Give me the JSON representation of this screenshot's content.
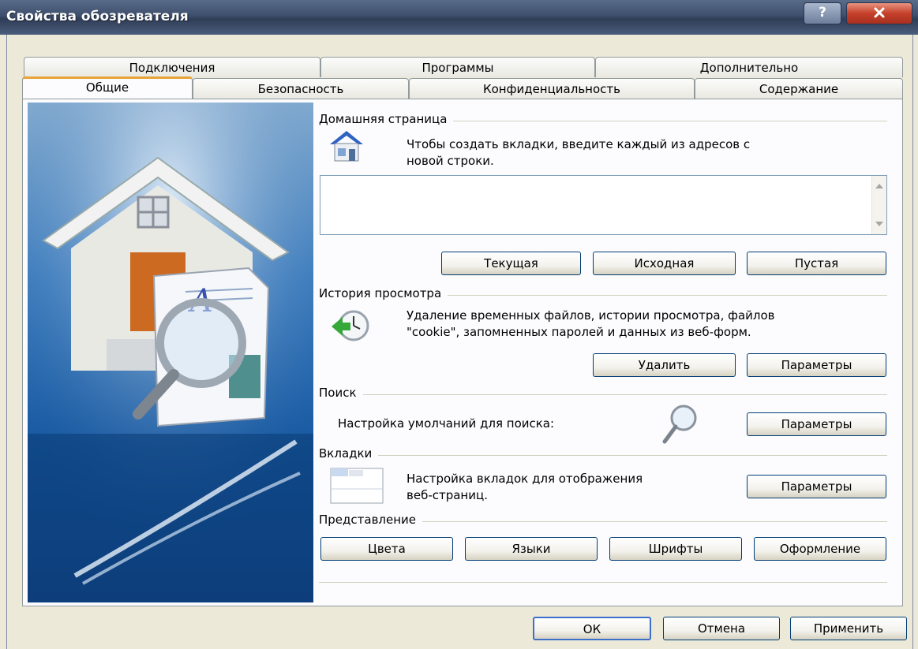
{
  "window": {
    "title": "Свойства обозревателя"
  },
  "tabs": {
    "row1": [
      "Подключения",
      "Программы",
      "Дополнительно"
    ],
    "row2": [
      "Общие",
      "Безопасность",
      "Конфиденциальность",
      "Содержание"
    ]
  },
  "home": {
    "title": "Домашняя страница",
    "desc_line1": "Чтобы создать вкладки, введите каждый из адресов с",
    "desc_line2": "новой строки.",
    "url_value": "",
    "btn_current": "Текущая",
    "btn_default": "Исходная",
    "btn_blank": "Пустая"
  },
  "history": {
    "title": "История просмотра",
    "desc_line1": "Удаление временных файлов, истории просмотра, файлов",
    "desc_line2": "\"cookie\", запомненных паролей и данных из веб-форм.",
    "btn_delete": "Удалить",
    "btn_params": "Параметры"
  },
  "search": {
    "title": "Поиск",
    "desc": "Настройка умолчаний для поиска:",
    "btn_params": "Параметры"
  },
  "tabs_section": {
    "title": "Вкладки",
    "desc_line1": "Настройка вкладок для отображения",
    "desc_line2": "веб-страниц.",
    "btn_params": "Параметры"
  },
  "view": {
    "title": "Представление",
    "btn_colors": "Цвета",
    "btn_languages": "Языки",
    "btn_fonts": "Шрифты",
    "btn_design": "Оформление"
  },
  "footer": {
    "ok": "ОК",
    "cancel": "Отмена",
    "apply": "Применить"
  }
}
